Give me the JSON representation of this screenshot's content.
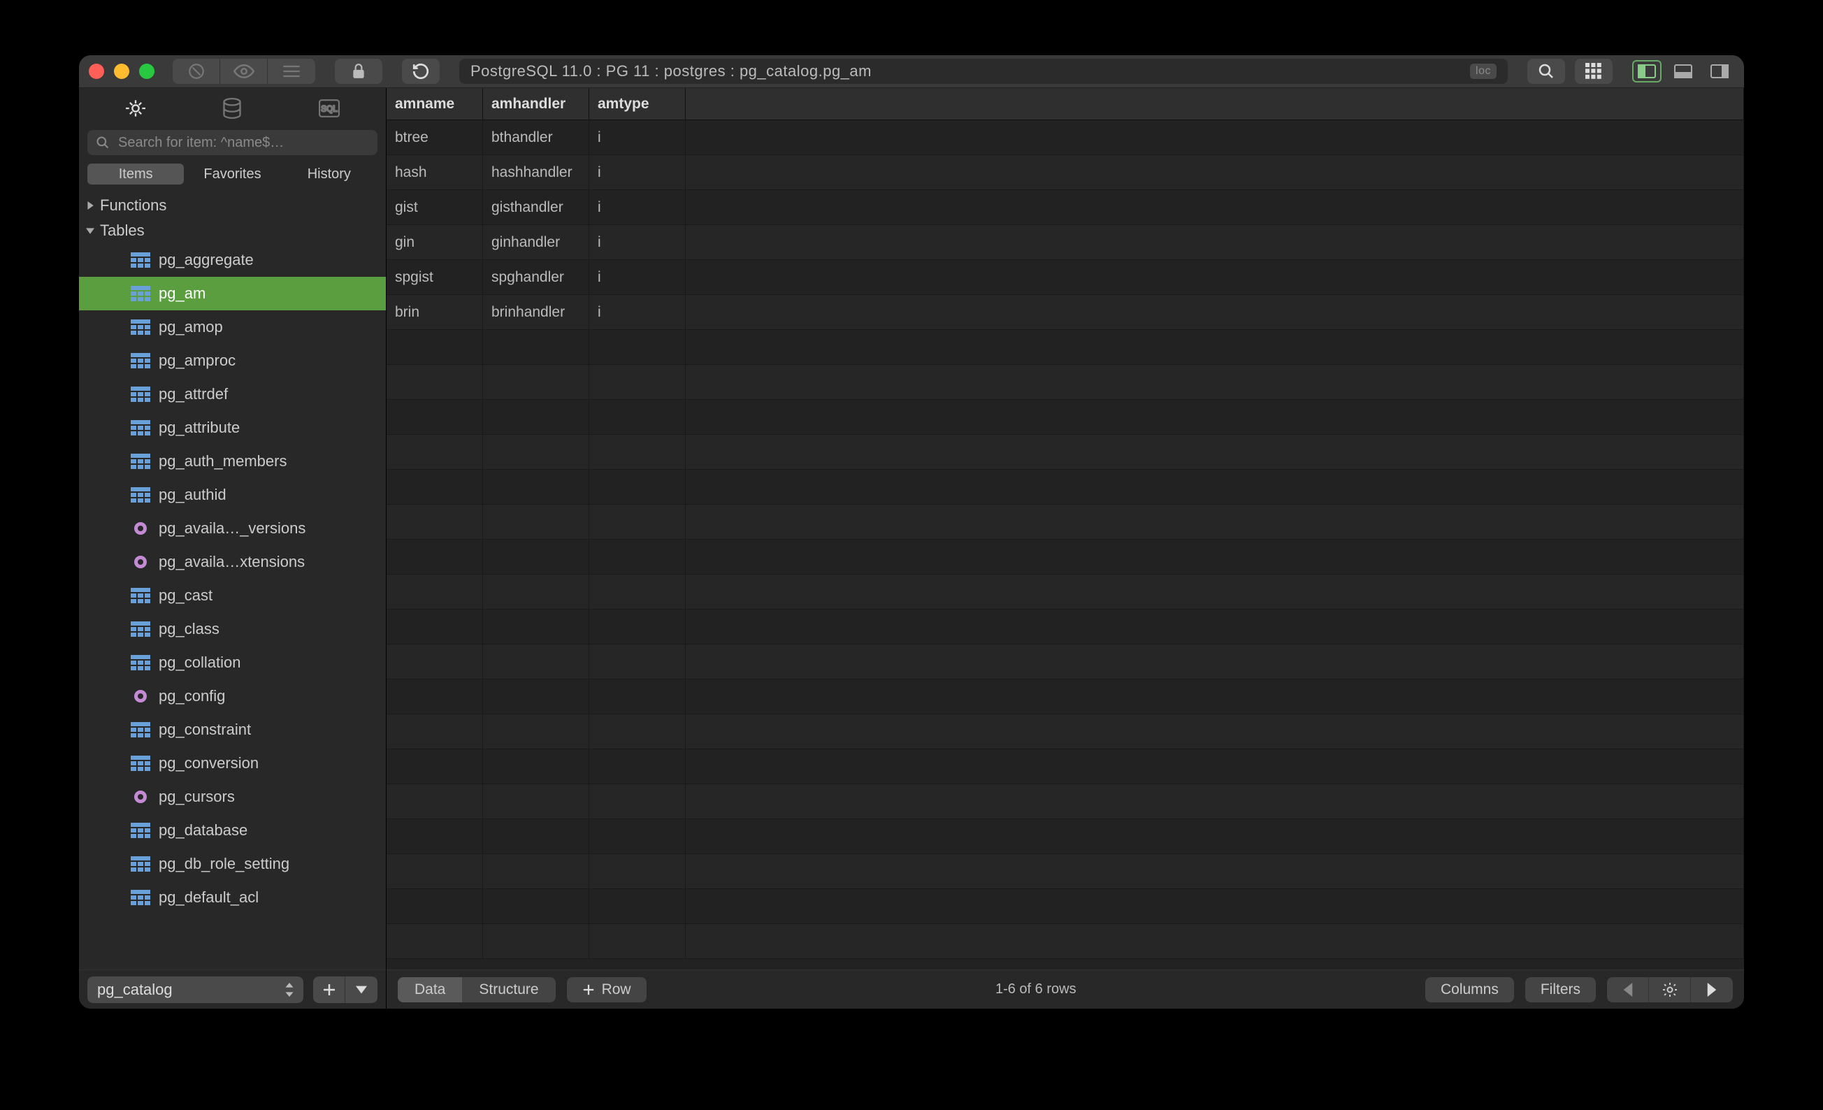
{
  "breadcrumb": "PostgreSQL 11.0 : PG 11 : postgres : pg_catalog.pg_am",
  "breadcrumb_badge": "loc",
  "search_placeholder": "Search for item: ^name$…",
  "filter_tabs": {
    "items": "Items",
    "favorites": "Favorites",
    "history": "History"
  },
  "tree": {
    "functions_label": "Functions",
    "tables_label": "Tables",
    "items": [
      {
        "label": "pg_aggregate",
        "type": "table"
      },
      {
        "label": "pg_am",
        "type": "table",
        "selected": true
      },
      {
        "label": "pg_amop",
        "type": "table"
      },
      {
        "label": "pg_amproc",
        "type": "table"
      },
      {
        "label": "pg_attrdef",
        "type": "table"
      },
      {
        "label": "pg_attribute",
        "type": "table"
      },
      {
        "label": "pg_auth_members",
        "type": "table"
      },
      {
        "label": "pg_authid",
        "type": "table"
      },
      {
        "label": "pg_availa…_versions",
        "type": "view"
      },
      {
        "label": "pg_availa…xtensions",
        "type": "view"
      },
      {
        "label": "pg_cast",
        "type": "table"
      },
      {
        "label": "pg_class",
        "type": "table"
      },
      {
        "label": "pg_collation",
        "type": "table"
      },
      {
        "label": "pg_config",
        "type": "view"
      },
      {
        "label": "pg_constraint",
        "type": "table"
      },
      {
        "label": "pg_conversion",
        "type": "table"
      },
      {
        "label": "pg_cursors",
        "type": "view"
      },
      {
        "label": "pg_database",
        "type": "table"
      },
      {
        "label": "pg_db_role_setting",
        "type": "table"
      },
      {
        "label": "pg_default_acl",
        "type": "table"
      }
    ]
  },
  "schema": "pg_catalog",
  "columns": [
    "amname",
    "amhandler",
    "amtype"
  ],
  "rows": [
    [
      "btree",
      "bthandler",
      "i"
    ],
    [
      "hash",
      "hashhandler",
      "i"
    ],
    [
      "gist",
      "gisthandler",
      "i"
    ],
    [
      "gin",
      "ginhandler",
      "i"
    ],
    [
      "spgist",
      "spghandler",
      "i"
    ],
    [
      "brin",
      "brinhandler",
      "i"
    ]
  ],
  "footer": {
    "data": "Data",
    "structure": "Structure",
    "row": "Row",
    "status": "1-6 of 6 rows",
    "columns": "Columns",
    "filters": "Filters"
  }
}
